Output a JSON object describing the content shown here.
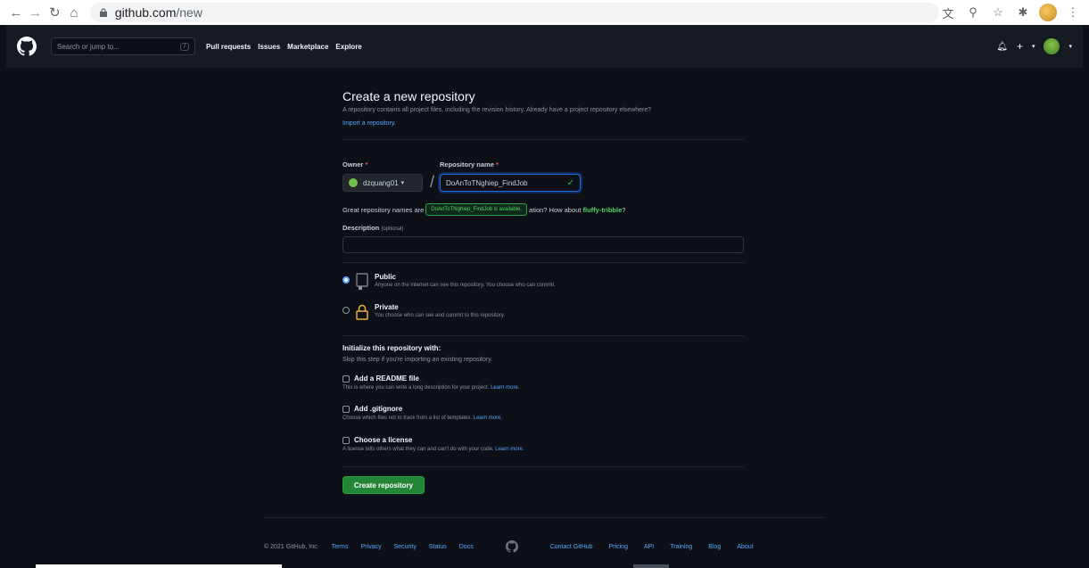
{
  "browser": {
    "url_host": "github.com",
    "url_path": "/new"
  },
  "header": {
    "search_placeholder": "Search or jump to...",
    "search_shortcut": "/",
    "nav": [
      "Pull requests",
      "Issues",
      "Marketplace",
      "Explore"
    ],
    "plus_label": "+"
  },
  "page": {
    "title": "Create a new repository",
    "subtitle": "A repository contains all project files, including the revision history. Already have a project repository elsewhere?",
    "import_link": "Import a repository."
  },
  "form": {
    "owner_label": "Owner",
    "owner_required": "*",
    "owner_value": "dzquang01",
    "owner_caret": "▾",
    "separator": "/",
    "repo_label": "Repository name",
    "repo_required": "*",
    "repo_value": "DoAnToTNghiep_FindJob",
    "great_prefix": "Great repository names are",
    "tooltip": "DoAnToTNghiep_FindJob is available.",
    "great_suffix": "ation? How about",
    "suggestion": "fluffy-tribble",
    "suggestion_end": "?",
    "desc_label": "Description",
    "desc_optional": "(optional)",
    "public_title": "Public",
    "public_desc": "Anyone on the internet can see this repository. You choose who can commit.",
    "private_title": "Private",
    "private_desc": "You choose who can see and commit to this repository.",
    "init_title": "Initialize this repository with:",
    "init_sub": "Skip this step if you're importing an existing repository.",
    "readme_title": "Add a README file",
    "readme_desc": "This is where you can write a long description for your project.",
    "gitignore_title": "Add .gitignore",
    "gitignore_desc": "Choose which files not to track from a list of templates.",
    "license_title": "Choose a license",
    "license_desc": "A license tells others what they can and can't do with your code.",
    "learn_more": "Learn more.",
    "create_button": "Create repository"
  },
  "footer": {
    "copyright": "© 2021 GitHub, Inc.",
    "links_left": [
      "Terms",
      "Privacy",
      "Security",
      "Status",
      "Docs"
    ],
    "links_right": [
      "Contact GitHub",
      "Pricing",
      "API",
      "Training",
      "Blog",
      "About"
    ]
  },
  "colors": {
    "accent": "#58a6ff",
    "success": "#238636",
    "background": "#0d1117"
  }
}
